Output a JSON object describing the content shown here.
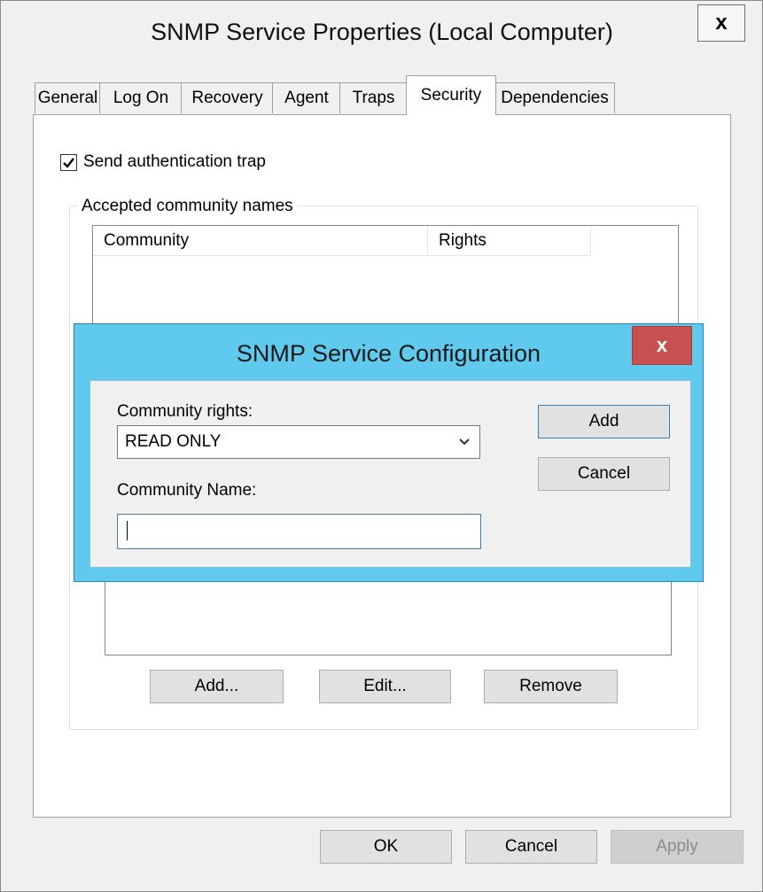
{
  "window": {
    "title": "SNMP Service Properties (Local Computer)",
    "close_label": "x"
  },
  "tabs": [
    {
      "label": "General"
    },
    {
      "label": "Log On"
    },
    {
      "label": "Recovery"
    },
    {
      "label": "Agent"
    },
    {
      "label": "Traps"
    },
    {
      "label": "Security",
      "active": true
    },
    {
      "label": "Dependencies"
    }
  ],
  "security": {
    "send_auth_trap_label": "Send authentication trap",
    "send_auth_trap_checked": true,
    "accepted_communities_legend": "Accepted community names",
    "columns": [
      "Community",
      "Rights"
    ],
    "add_button": "Add...",
    "edit_button": "Edit...",
    "remove_button": "Remove"
  },
  "footer": {
    "ok_button": "OK",
    "cancel_button": "Cancel",
    "apply_button": "Apply"
  },
  "dialog": {
    "title": "SNMP Service Configuration",
    "close_label": "x",
    "rights_label": "Community rights:",
    "rights_value": "READ ONLY",
    "name_label": "Community Name:",
    "name_value": "",
    "add_button": "Add",
    "cancel_button": "Cancel"
  },
  "colors": {
    "dialog_frame": "#5fcaee",
    "dialog_close": "#c75050"
  }
}
